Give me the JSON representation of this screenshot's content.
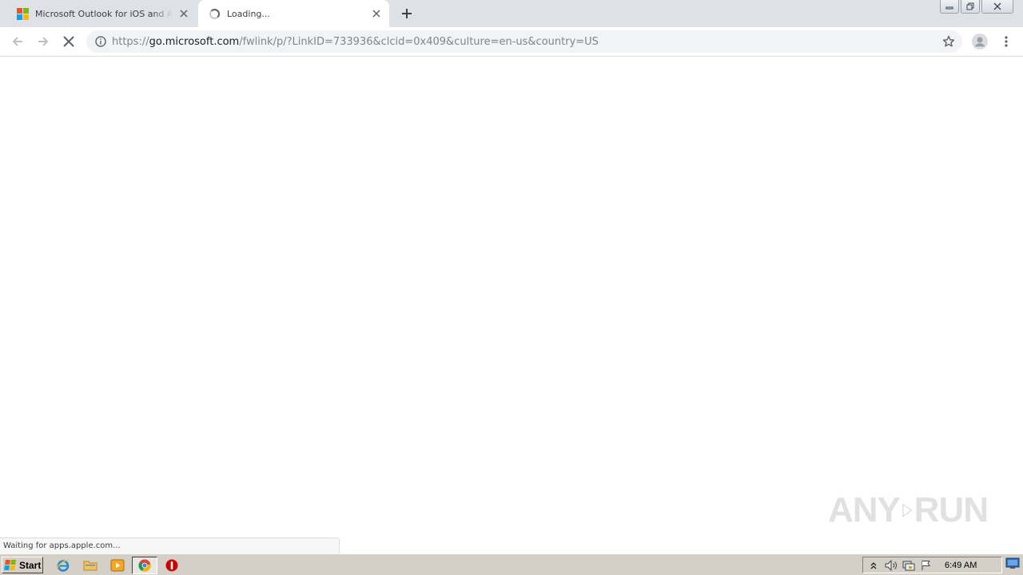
{
  "browser": {
    "tabs": [
      {
        "title": "Microsoft Outlook for iOS and Android",
        "icon": "microsoft-logo-icon",
        "active": false
      },
      {
        "title": "Loading...",
        "icon": "loading-spinner-icon",
        "active": true
      }
    ],
    "address": {
      "scheme": "https://",
      "host": "go.microsoft.com",
      "path": "/fwlink/p/?LinkID=733936&clcid=0x409&culture=en-us&country=US"
    },
    "status_text": "Waiting for apps.apple.com..."
  },
  "watermark": {
    "left": "ANY",
    "right": "RUN"
  },
  "taskbar": {
    "start_label": "Start",
    "clock": "6:49 AM"
  },
  "colors": {
    "ms_red": "#f25022",
    "ms_green": "#7fba00",
    "ms_blue": "#00a4ef",
    "ms_yellow": "#ffb900",
    "tab_strip": "#dee1e6",
    "omnibox": "#f1f3f4"
  }
}
